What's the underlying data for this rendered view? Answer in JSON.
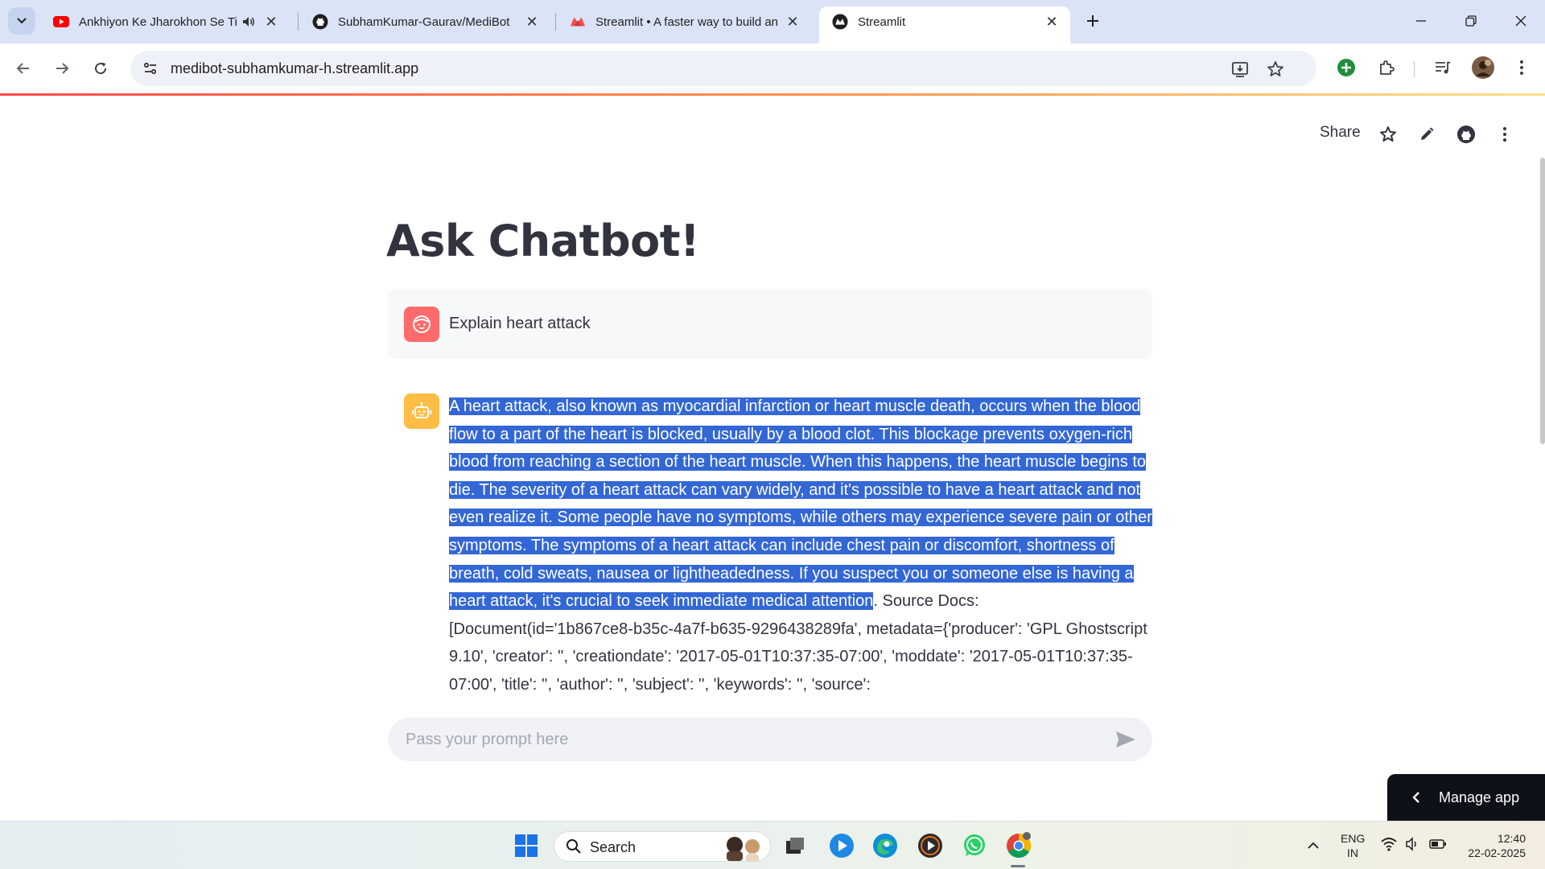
{
  "browser": {
    "tabs": [
      {
        "title": "Ankhiyon Ke Jharokhon Se Titl",
        "favicon": "youtube-icon",
        "audio": true
      },
      {
        "title": "SubhamKumar-Gaurav/MediBot",
        "favicon": "github-icon"
      },
      {
        "title": "Streamlit • A faster way to build an",
        "favicon": "streamlit-icon"
      },
      {
        "title": "Streamlit",
        "favicon": "streamlit-dark-icon",
        "active": true
      }
    ],
    "url": "medibot-subhamkumar-h.streamlit.app"
  },
  "app": {
    "share_label": "Share",
    "title": "Ask Chatbot!",
    "user_message": "Explain heart attack",
    "bot_message_highlighted": "A heart attack, also known as myocardial infarction or heart muscle death, occurs when the blood flow to a part of the heart is blocked, usually by a blood clot. This blockage prevents oxygen-rich blood from reaching a section of the heart muscle. When this happens, the heart muscle begins to die. The severity of a heart attack can vary widely, and it's possible to have a heart attack and not even realize it. Some people have no symptoms, while others may experience severe pain or other symptoms. The symptoms of a heart attack can include chest pain or discomfort, shortness of breath, cold sweats, nausea or lightheadedness. If you suspect you or someone else is having a heart attack, it's crucial to seek immediate medical attention",
    "bot_message_rest": ". Source Docs: [Document(id='1b867ce8-b35c-4a7f-b635-9296438289fa', metadata={'producer': 'GPL Ghostscript 9.10', 'creator': '', 'creationdate': '2017-05-01T10:37:35-07:00', 'moddate': '2017-05-01T10:37:35-07:00', 'title': '', 'author': '', 'subject': '', 'keywords': '', 'source':",
    "input_placeholder": "Pass your prompt here",
    "manage_app_label": "Manage app"
  },
  "taskbar": {
    "search_label": "Search",
    "language": "ENG",
    "region": "IN",
    "time": "12:40",
    "date": "22-02-2025"
  }
}
